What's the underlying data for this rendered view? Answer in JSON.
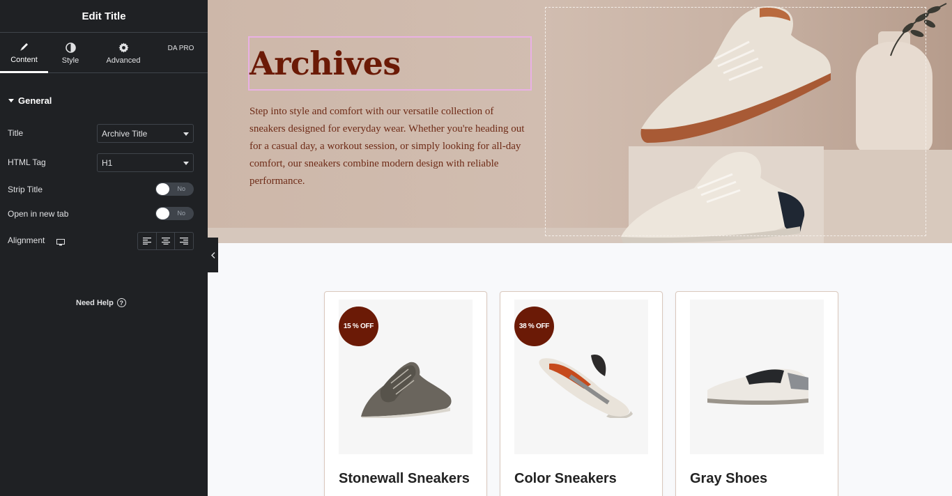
{
  "panel": {
    "title": "Edit Title",
    "tabs": [
      {
        "label": "Content",
        "icon": "pencil-icon",
        "active": true
      },
      {
        "label": "Style",
        "icon": "half-circle-icon",
        "active": false
      },
      {
        "label": "Advanced",
        "icon": "gear-icon",
        "active": false
      },
      {
        "label": "DA PRO",
        "icon": "",
        "active": false
      }
    ],
    "section": "General",
    "controls": {
      "title_label": "Title",
      "title_value": "Archive Title",
      "html_tag_label": "HTML Tag",
      "html_tag_value": "H1",
      "strip_title_label": "Strip Title",
      "strip_title_value": "No",
      "new_tab_label": "Open in new tab",
      "new_tab_value": "No",
      "alignment_label": "Alignment"
    },
    "need_help": "Need Help"
  },
  "hero": {
    "title": "Archives",
    "description": "Step into style and comfort with our versatile collection of sneakers designed for everyday wear. Whether you're heading out for a casual day, a workout session, or simply looking for all-day comfort, our sneakers combine modern design with reliable performance."
  },
  "products": [
    {
      "name": "Stonewall Sneakers",
      "badge": "15 % OFF"
    },
    {
      "name": "Color Sneakers",
      "badge": "38 % OFF"
    },
    {
      "name": "Gray Shoes",
      "badge": ""
    }
  ],
  "colors": {
    "panel_bg": "#1f2124",
    "brand": "#6b1a06",
    "selection_outline": "#e9b1e4"
  }
}
